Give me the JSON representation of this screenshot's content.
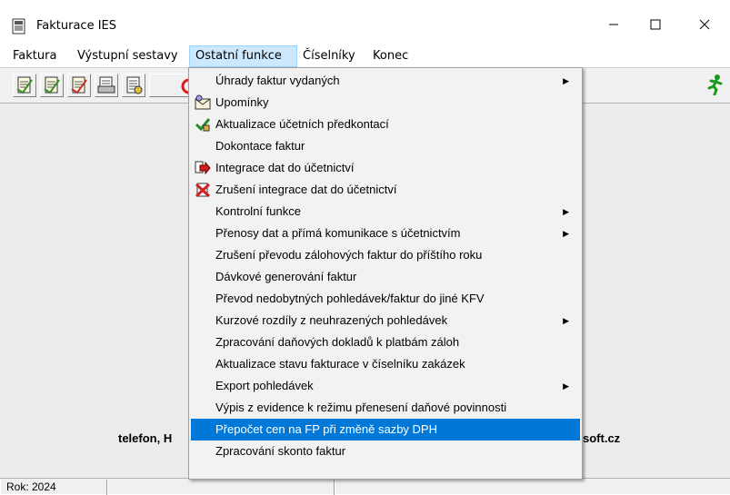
{
  "window": {
    "title": "Fakturace IES",
    "minimize_glyph": "—",
    "maximize_glyph": "☐",
    "close_glyph": "✕"
  },
  "menubar": {
    "items": [
      {
        "label": "Faktura"
      },
      {
        "label": "Výstupní sestavy"
      },
      {
        "label": "Ostatní funkce",
        "active": true
      },
      {
        "label": "Číselníky"
      },
      {
        "label": "Konec"
      }
    ]
  },
  "toolbar": {
    "buttons": [
      "invoice-icon",
      "invoice-icon",
      "invoice-icon",
      "printer-doc-icon",
      "list-doc-icon",
      "stop-icon"
    ],
    "exit_icon": "running-man-icon"
  },
  "dropdown": {
    "items": [
      {
        "label": "Úhrady faktur vydaných",
        "submenu": true
      },
      {
        "label": "Upomínky",
        "icon": "envelope-icon"
      },
      {
        "label": "Aktualizace účetních předkontací",
        "icon": "check-pencil-icon"
      },
      {
        "label": "Dokontace faktur"
      },
      {
        "label": "Integrace dat do účetnictví",
        "icon": "arrow-red-icon"
      },
      {
        "label": "Zrušení integrace dat do účetnictví",
        "icon": "cross-icon"
      },
      {
        "label": "Kontrolní funkce",
        "submenu": true
      },
      {
        "label": "Přenosy dat a přímá komunikace s účetnictvím",
        "submenu": true
      },
      {
        "label": "Zrušení převodu zálohových faktur do příštího roku"
      },
      {
        "label": "Dávkové generování faktur"
      },
      {
        "label": "Převod nedobytných pohledávek/faktur do jiné KFV"
      },
      {
        "label": "Kurzové rozdíly z neuhrazených pohledávek",
        "submenu": true
      },
      {
        "label": "Zpracování daňových dokladů k platbám záloh"
      },
      {
        "label": "Aktualizace stavu fakturace v číselníku zakázek"
      },
      {
        "label": "Export pohledávek",
        "submenu": true
      },
      {
        "label": "Výpis z evidence k režimu přenesení daňové povinnosti"
      },
      {
        "label": "Přepočet cen na FP při změně sazby DPH",
        "highlighted": true
      },
      {
        "label": "Zpracování skonto faktur"
      }
    ],
    "highlight_color": "#0078d7"
  },
  "client": {
    "left_text": "telefon, H",
    "right_text": "soft.cz"
  },
  "statusbar": {
    "year_label": "Rok: 2024"
  }
}
